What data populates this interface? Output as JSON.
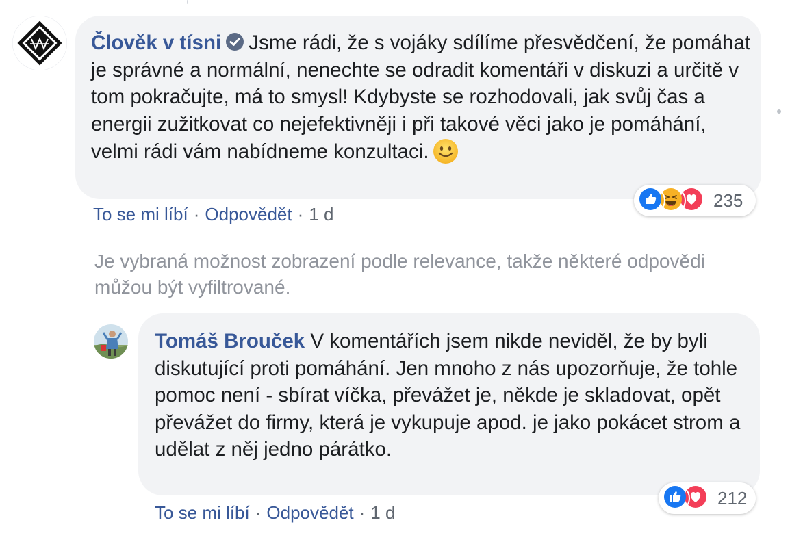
{
  "comment1": {
    "author": "Člověk v tísni",
    "verified_icon": "verified-badge",
    "text": "Jsme rádi, že s vojáky sdílíme přesvědčení, že pomáhat je správné a normální, nenechte se odradit komentáři v diskuzi a určitě v tom pokračujte, má to smysl! Kdybyste se rozhodovali, jak svůj čas a energii zužitkovat co nejefektivněji i při takové věci jako je pomáhání, velmi rádi vám nabídneme konzultaci.",
    "emoji": "slightly-smiling-face",
    "reactions": {
      "icons": [
        "like",
        "haha",
        "love"
      ],
      "count": "235"
    },
    "actions": {
      "like": "To se mi líbí",
      "sep": "·",
      "reply": "Odpovědět",
      "time": "1 d"
    }
  },
  "filter_notice": "Je vybraná možnost zobrazení podle relevance, takže některé odpovědi můžou být vyfiltrované.",
  "comment2": {
    "author": "Tomáš Brouček",
    "text": "V komentářích jsem nikde neviděl, že by byli diskutující proti pomáhání. Jen mnoho z nás upozorňuje, že tohle pomoc není - sbírat víčka, převážet je, někde je skladovat, opět převážet do firmy, která je vykupuje apod. je jako pokácet strom a udělat z něj jedno párátko.",
    "reactions": {
      "icons": [
        "like",
        "love"
      ],
      "count": "212"
    },
    "actions": {
      "like": "To se mi líbí",
      "sep": "·",
      "reply": "Odpovědět",
      "time": "1 d"
    }
  },
  "colors": {
    "author": "#385898",
    "bubble": "#f2f3f5",
    "meta": "#606770",
    "notice": "#90949c",
    "like": "#1877f2",
    "love": "#f33e58",
    "haha": "#f7b125"
  }
}
